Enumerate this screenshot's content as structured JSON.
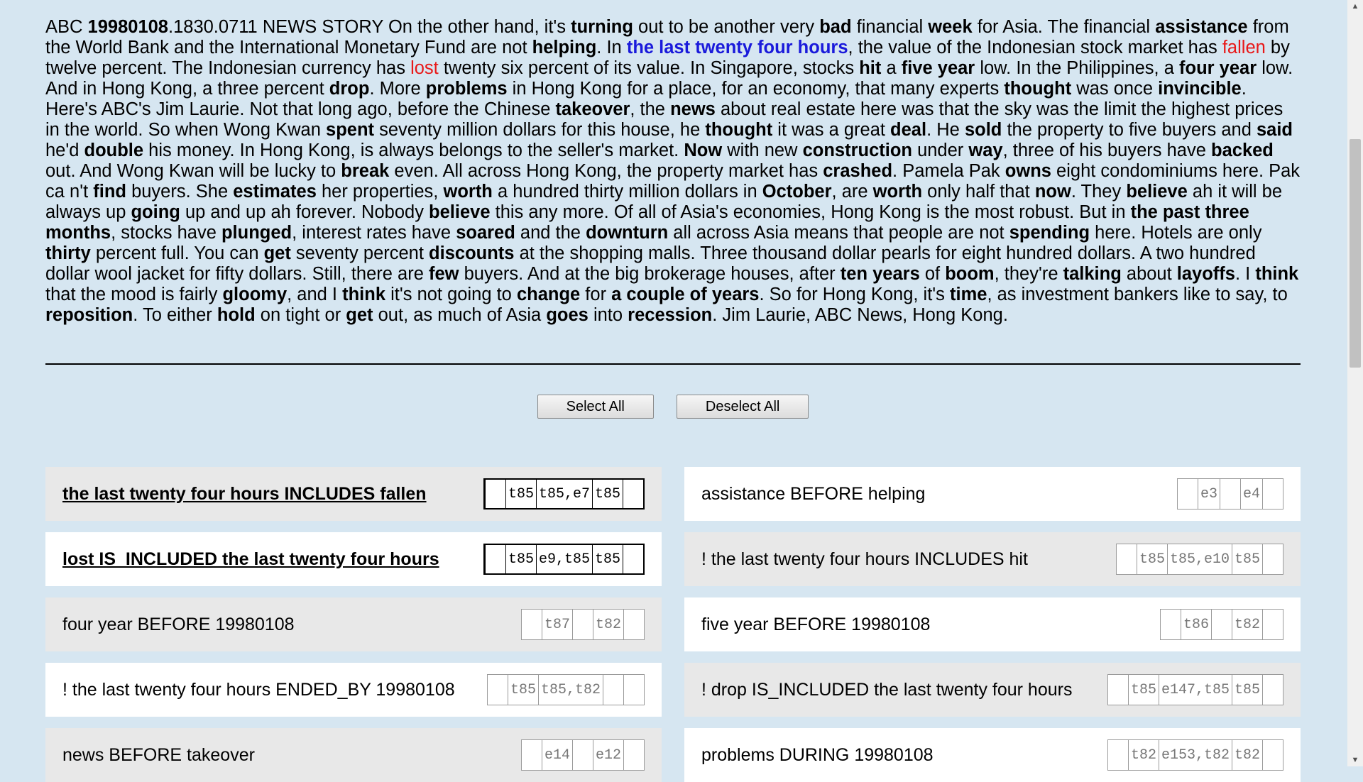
{
  "story": {
    "segments": [
      {
        "t": "ABC "
      },
      {
        "t": "19980108",
        "s": "b"
      },
      {
        "t": ".1830.0711 NEWS STORY On the other hand, it's "
      },
      {
        "t": "turning",
        "s": "b"
      },
      {
        "t": " out to be another very "
      },
      {
        "t": "bad",
        "s": "b"
      },
      {
        "t": " financial "
      },
      {
        "t": "week",
        "s": "b"
      },
      {
        "t": " for Asia. The financial "
      },
      {
        "t": "assistance",
        "s": "b"
      },
      {
        "t": " from the World Bank and the International Monetary Fund are not "
      },
      {
        "t": "helping",
        "s": "b"
      },
      {
        "t": ". In "
      },
      {
        "t": "the last twenty four hours",
        "s": "blue"
      },
      {
        "t": ", the value of the Indonesian stock market has "
      },
      {
        "t": "fallen",
        "s": "red"
      },
      {
        "t": " by twelve percent. The Indonesian currency has "
      },
      {
        "t": "lost",
        "s": "red"
      },
      {
        "t": " twenty six percent of its value. In Singapore, stocks "
      },
      {
        "t": "hit",
        "s": "b"
      },
      {
        "t": " a "
      },
      {
        "t": "five year",
        "s": "b"
      },
      {
        "t": " low. In the Philippines, a "
      },
      {
        "t": "four year",
        "s": "b"
      },
      {
        "t": " low. And in Hong Kong, a three percent "
      },
      {
        "t": "drop",
        "s": "b"
      },
      {
        "t": ". More "
      },
      {
        "t": "problems",
        "s": "b"
      },
      {
        "t": " in Hong Kong for a place, for an economy, that many experts "
      },
      {
        "t": "thought",
        "s": "b"
      },
      {
        "t": " was once "
      },
      {
        "t": "invincible",
        "s": "b"
      },
      {
        "t": ". Here's ABC's Jim Laurie. Not that long ago, before the Chinese "
      },
      {
        "t": "takeover",
        "s": "b"
      },
      {
        "t": ", the "
      },
      {
        "t": "news",
        "s": "b"
      },
      {
        "t": " about real estate here was that the sky was the limit the highest prices in the world. So when Wong Kwan "
      },
      {
        "t": "spent",
        "s": "b"
      },
      {
        "t": " seventy million dollars for this house, he "
      },
      {
        "t": "thought",
        "s": "b"
      },
      {
        "t": " it was a great "
      },
      {
        "t": "deal",
        "s": "b"
      },
      {
        "t": ". He "
      },
      {
        "t": "sold",
        "s": "b"
      },
      {
        "t": " the property to five buyers and "
      },
      {
        "t": "said",
        "s": "b"
      },
      {
        "t": " he'd "
      },
      {
        "t": "double",
        "s": "b"
      },
      {
        "t": " his money. In Hong Kong, is always belongs to the seller's market. "
      },
      {
        "t": "Now",
        "s": "b"
      },
      {
        "t": " with new "
      },
      {
        "t": "construction",
        "s": "b"
      },
      {
        "t": " under "
      },
      {
        "t": "way",
        "s": "b"
      },
      {
        "t": ", three of his buyers have "
      },
      {
        "t": "backed",
        "s": "b"
      },
      {
        "t": " out. And Wong Kwan will be lucky to "
      },
      {
        "t": "break",
        "s": "b"
      },
      {
        "t": " even. All across Hong Kong, the property market has "
      },
      {
        "t": "crashed",
        "s": "b"
      },
      {
        "t": ". Pamela Pak "
      },
      {
        "t": "owns",
        "s": "b"
      },
      {
        "t": " eight condominiums here. Pak ca n't "
      },
      {
        "t": "find",
        "s": "b"
      },
      {
        "t": " buyers. She "
      },
      {
        "t": "estimates",
        "s": "b"
      },
      {
        "t": " her properties, "
      },
      {
        "t": "worth",
        "s": "b"
      },
      {
        "t": " a hundred thirty million dollars in "
      },
      {
        "t": "October",
        "s": "b"
      },
      {
        "t": ", are "
      },
      {
        "t": "worth",
        "s": "b"
      },
      {
        "t": " only half that "
      },
      {
        "t": "now",
        "s": "b"
      },
      {
        "t": ". They "
      },
      {
        "t": "believe",
        "s": "b"
      },
      {
        "t": " ah it will be always up "
      },
      {
        "t": "going",
        "s": "b"
      },
      {
        "t": " up and up ah forever. Nobody "
      },
      {
        "t": "believe",
        "s": "b"
      },
      {
        "t": " this any more. Of all of Asia's economies, Hong Kong is the most robust. But in "
      },
      {
        "t": "the past three months",
        "s": "b"
      },
      {
        "t": ", stocks have "
      },
      {
        "t": "plunged",
        "s": "b"
      },
      {
        "t": ", interest rates have "
      },
      {
        "t": "soared",
        "s": "b"
      },
      {
        "t": " and the "
      },
      {
        "t": "downturn",
        "s": "b"
      },
      {
        "t": " all across Asia means that people are not "
      },
      {
        "t": "spending",
        "s": "b"
      },
      {
        "t": " here. Hotels are only "
      },
      {
        "t": "thirty",
        "s": "b"
      },
      {
        "t": " percent full. You can "
      },
      {
        "t": "get",
        "s": "b"
      },
      {
        "t": " seventy percent "
      },
      {
        "t": "discounts",
        "s": "b"
      },
      {
        "t": " at the shopping malls. Three thousand dollar pearls for eight hundred dollars. A two hundred dollar wool jacket for fifty dollars. Still, there are "
      },
      {
        "t": "few",
        "s": "b"
      },
      {
        "t": " buyers. And at the big brokerage houses, after "
      },
      {
        "t": "ten years",
        "s": "b"
      },
      {
        "t": " of "
      },
      {
        "t": "boom",
        "s": "b"
      },
      {
        "t": ", they're "
      },
      {
        "t": "talking",
        "s": "b"
      },
      {
        "t": " about "
      },
      {
        "t": "layoffs",
        "s": "b"
      },
      {
        "t": ". I "
      },
      {
        "t": "think",
        "s": "b"
      },
      {
        "t": " that the mood is fairly "
      },
      {
        "t": "gloomy",
        "s": "b"
      },
      {
        "t": ", and I "
      },
      {
        "t": "think",
        "s": "b"
      },
      {
        "t": " it's not going to "
      },
      {
        "t": "change",
        "s": "b"
      },
      {
        "t": " for "
      },
      {
        "t": "a couple of years",
        "s": "b"
      },
      {
        "t": ". So for Hong Kong, it's "
      },
      {
        "t": "time",
        "s": "b"
      },
      {
        "t": ", as investment bankers like to say, to "
      },
      {
        "t": "reposition",
        "s": "b"
      },
      {
        "t": ". To either "
      },
      {
        "t": "hold",
        "s": "b"
      },
      {
        "t": " on tight or "
      },
      {
        "t": "get",
        "s": "b"
      },
      {
        "t": " out, as much of Asia "
      },
      {
        "t": "goes",
        "s": "b"
      },
      {
        "t": " into "
      },
      {
        "t": "recession",
        "s": "b"
      },
      {
        "t": ". Jim Laurie, ABC News, Hong Kong."
      }
    ]
  },
  "buttons": {
    "select_all": "Select All",
    "deselect_all": "Deselect All"
  },
  "relations": [
    {
      "label": "the last twenty four hours INCLUDES fallen",
      "ids": [
        "",
        "t85",
        "t85,e7",
        "t85",
        ""
      ],
      "selected": true,
      "bg": "grey"
    },
    {
      "label": "assistance BEFORE helping",
      "ids": [
        "",
        "e3",
        "",
        "e4",
        ""
      ],
      "selected": false,
      "bg": "white"
    },
    {
      "label": "lost IS_INCLUDED the last twenty four hours",
      "ids": [
        "",
        "t85",
        "e9,t85",
        "t85",
        ""
      ],
      "selected": true,
      "bg": "white"
    },
    {
      "label": "! the last twenty four hours INCLUDES hit",
      "ids": [
        "",
        "t85",
        "t85,e10",
        "t85",
        ""
      ],
      "selected": false,
      "bg": "grey"
    },
    {
      "label": "four year BEFORE 19980108",
      "ids": [
        "",
        "t87",
        "",
        "t82",
        ""
      ],
      "selected": false,
      "bg": "grey"
    },
    {
      "label": "five year BEFORE 19980108",
      "ids": [
        "",
        "t86",
        "",
        "t82",
        ""
      ],
      "selected": false,
      "bg": "white"
    },
    {
      "label": "! the last twenty four hours ENDED_BY 19980108",
      "ids": [
        "",
        "t85",
        "t85,t82",
        "",
        ""
      ],
      "selected": false,
      "bg": "white"
    },
    {
      "label": "! drop IS_INCLUDED the last twenty four hours",
      "ids": [
        "",
        "t85",
        "e147,t85",
        "t85",
        ""
      ],
      "selected": false,
      "bg": "grey"
    },
    {
      "label": "news BEFORE takeover",
      "ids": [
        "",
        "e14",
        "",
        "e12",
        ""
      ],
      "selected": false,
      "bg": "grey"
    },
    {
      "label": "problems DURING 19980108",
      "ids": [
        "",
        "t82",
        "e153,t82",
        "t82",
        ""
      ],
      "selected": false,
      "bg": "white"
    }
  ]
}
